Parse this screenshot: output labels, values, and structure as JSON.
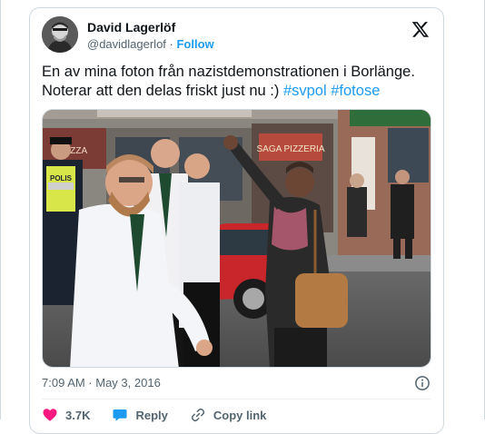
{
  "author": {
    "name": "David Lagerlöf",
    "handle": "@davidlagerlof",
    "separator": " · ",
    "follow_label": "Follow"
  },
  "tweet": {
    "text_line1": "En av mina foton från nazistdemonstrationen i Borlänge.",
    "text_line2": "Noterar att den delas friskt just nu :) ",
    "hashtags": [
      "#svpol",
      "#fotose"
    ],
    "image_text": {
      "shop_sign": "PIZZA",
      "shop_sign_2": "SAGA PIZZERIA",
      "police_vest": "POLIS"
    }
  },
  "meta": {
    "timestamp": "7:09 AM · May 3, 2016"
  },
  "actions": {
    "like_count": "3.7K",
    "reply_label": "Reply",
    "copy_link_label": "Copy link"
  },
  "colors": {
    "accent": "#1d9bf0",
    "like": "#f91880",
    "reply": "#1d9bf0",
    "muted": "#536471"
  },
  "icons": [
    "x-logo-icon",
    "info-icon",
    "heart-icon",
    "reply-bubble-icon",
    "link-icon"
  ]
}
